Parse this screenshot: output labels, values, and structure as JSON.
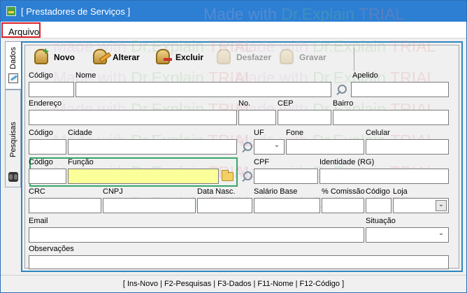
{
  "window": {
    "title": "[ Prestadores de Serviços ]"
  },
  "menu": {
    "arquivo": "Arquivo"
  },
  "tabs": {
    "dados": "Dados",
    "pesquisas": "Pesquisas"
  },
  "toolbar": {
    "novo": "Novo",
    "alterar": "Alterar",
    "excluir": "Excluir",
    "desfazer": "Desfazer",
    "gravar": "Gravar"
  },
  "labels": {
    "codigo": "Código",
    "nome": "Nome",
    "apelido": "Apelido",
    "endereco": "Endereço",
    "no": "No.",
    "cep": "CEP",
    "bairro": "Bairro",
    "cidade": "Cidade",
    "uf": "UF",
    "fone": "Fone",
    "celular": "Celular",
    "funcao": "Função",
    "cpf": "CPF",
    "identidade": "Identidade (RG)",
    "crc": "CRC",
    "cnpj": "CNPJ",
    "data_nasc": "Data Nasc.",
    "salario_base": "Salário Base",
    "comissao": "% Comissão",
    "codigo_loja": "Código",
    "loja": "Loja",
    "email": "Email",
    "situacao": "Situação",
    "observacoes": "Observações"
  },
  "watermark": {
    "made": "Made with",
    "dr": "Dr.Explain",
    "trial": "TRIAL"
  },
  "status": {
    "shortcuts": "[ Ins-Novo | F2-Pesquisas | F3-Dados | F11-Nome | F12-Código ]"
  }
}
